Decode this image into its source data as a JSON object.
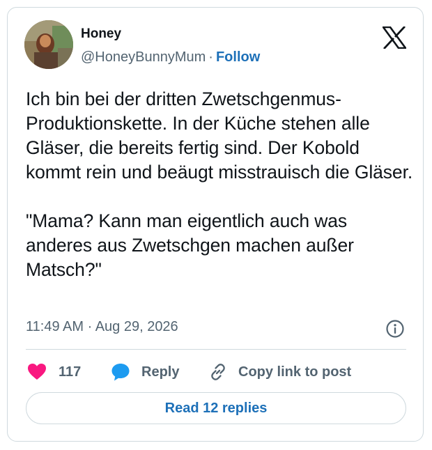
{
  "author": {
    "display_name": "Honey",
    "handle": "@HoneyBunnyMum",
    "separator": "·",
    "follow_label": "Follow"
  },
  "brand_icon": "x-logo-icon",
  "tweet": {
    "paragraphs": [
      "Ich bin bei der dritten Zwetschgenmus-Produktionskette. In der Küche stehen alle Gläser, die bereits fertig sind. Der Kobold kommt rein und beäugt misstrauisch die Gläser.",
      "\"Mama? Kann man eigentlich auch was anderes aus Zwetschgen machen außer Matsch?\""
    ],
    "timestamp": "11:49 AM · Aug 29, 2026"
  },
  "actions": {
    "like_count": "117",
    "reply_label": "Reply",
    "copy_link_label": "Copy link to post"
  },
  "read_replies_label": "Read 12 replies",
  "icons": {
    "like": "heart-icon",
    "reply": "speech-bubble-icon",
    "copy": "link-icon",
    "info": "info-icon"
  },
  "colors": {
    "text": "#0f1419",
    "secondary": "#536471",
    "link": "#1d70b8",
    "heart": "#f91880",
    "reply_bubble": "#1d9bf0",
    "border": "#cfd9de"
  }
}
